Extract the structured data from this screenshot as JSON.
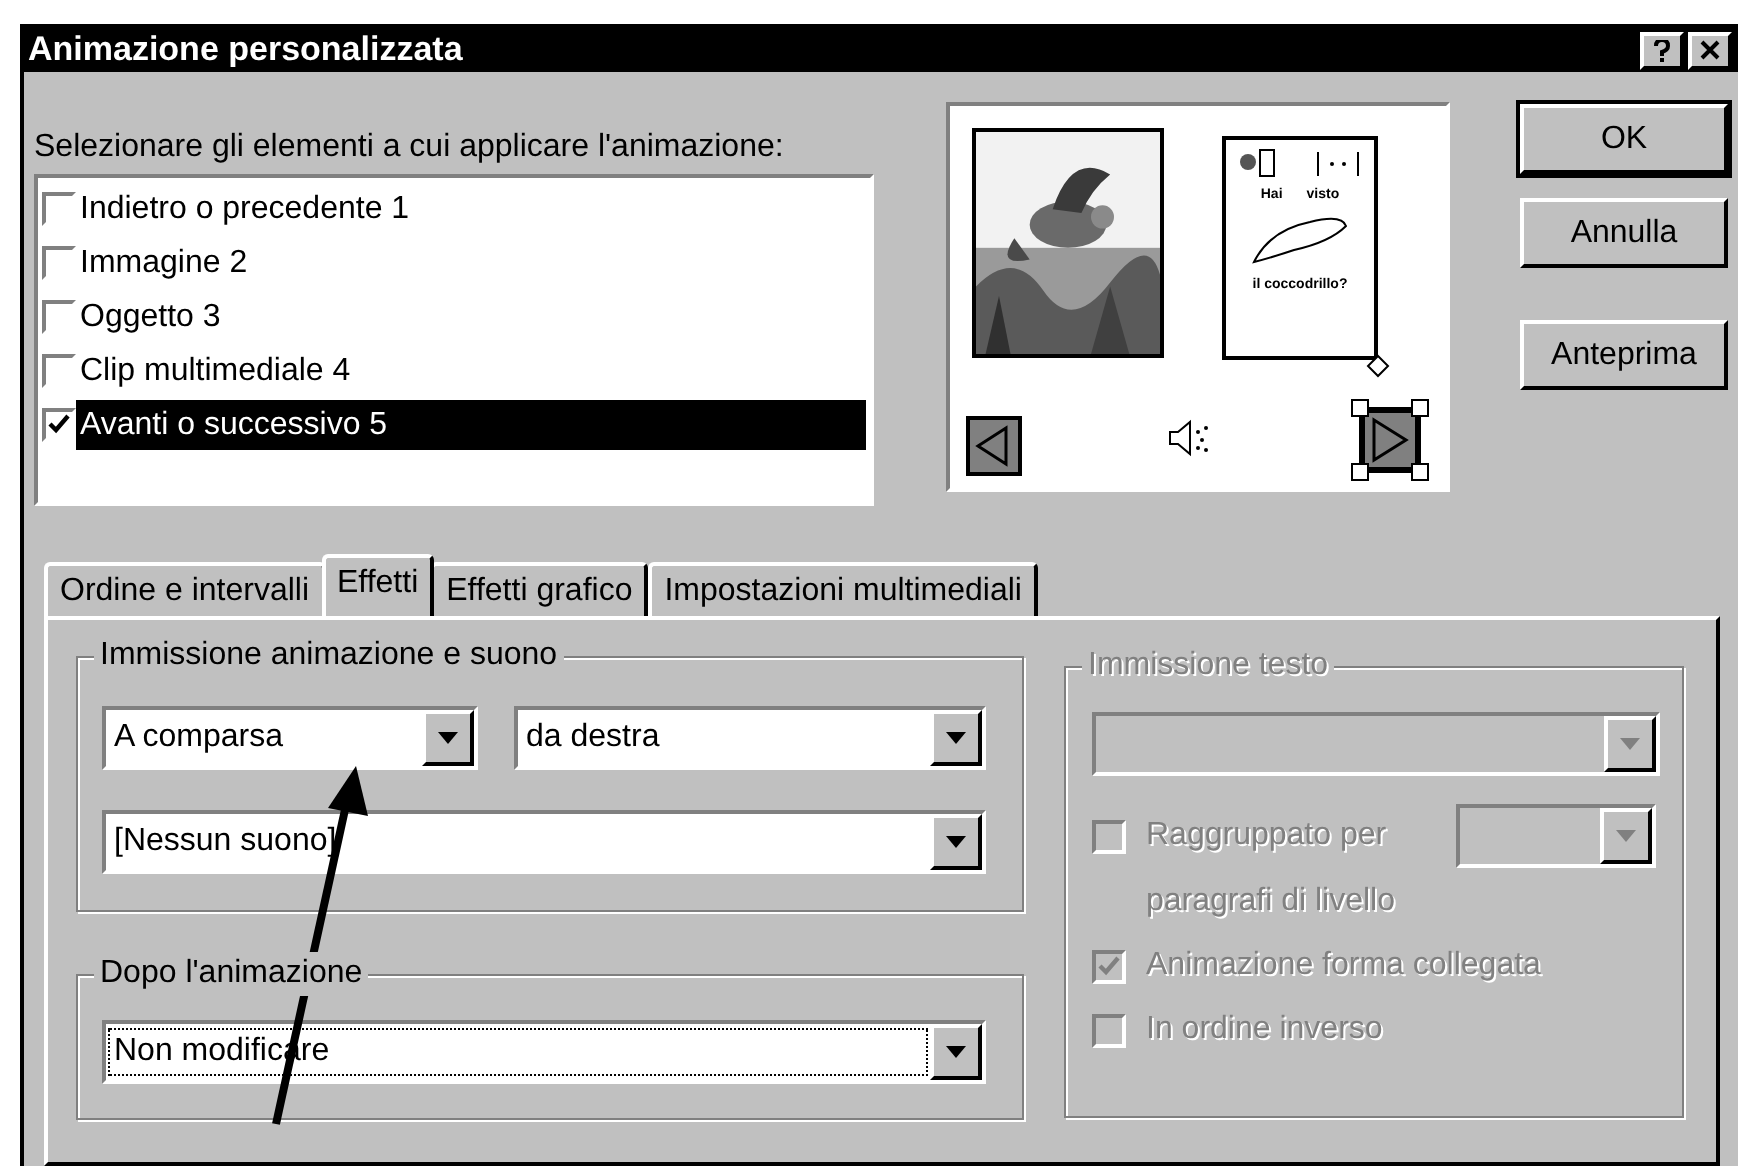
{
  "window": {
    "title": "Animazione personalizzata"
  },
  "elements_label": {
    "text": "Selezionare gli elementi a cui applicare l'animazione:"
  },
  "elements": [
    {
      "label": "Indietro o precedente 1",
      "checked": false,
      "selected": false
    },
    {
      "label": "Immagine 2",
      "checked": false,
      "selected": false
    },
    {
      "label": "Oggetto 3",
      "checked": false,
      "selected": false
    },
    {
      "label": "Clip multimediale 4",
      "checked": false,
      "selected": false
    },
    {
      "label": "Avanti o successivo 5",
      "checked": true,
      "selected": true
    }
  ],
  "preview": {
    "card_texts": [
      "Hai",
      "visto",
      "il coccodrillo?"
    ]
  },
  "buttons": [
    {
      "label": "OK",
      "default": true
    },
    {
      "label": "Annulla",
      "default": false
    },
    {
      "label": "Anteprima",
      "default": false
    }
  ],
  "tabs": [
    {
      "label": "Ordine e intervalli",
      "selected": false
    },
    {
      "label": "Effetti",
      "selected": true
    },
    {
      "label": "Effetti grafico",
      "selected": false
    },
    {
      "label": "Impostazioni multimediali",
      "selected": false
    }
  ],
  "entry_group": {
    "title": "Immissione animazione e suono",
    "effect": "A comparsa",
    "direction": "da destra",
    "sound": "[Nessun suono]"
  },
  "after_group": {
    "title": "Dopo l'animazione",
    "value": "Non modificare",
    "focused": true
  },
  "text_group": {
    "title": "Immissione testo",
    "disabled": true,
    "options": [
      {
        "kind": "grouped",
        "label": "Raggruppato per",
        "checked": false,
        "continuation": "paragrafi di livello"
      },
      {
        "kind": "check",
        "label": "Animazione forma collegata",
        "checked": true
      },
      {
        "kind": "check",
        "label": "In ordine inverso",
        "checked": false
      }
    ]
  }
}
